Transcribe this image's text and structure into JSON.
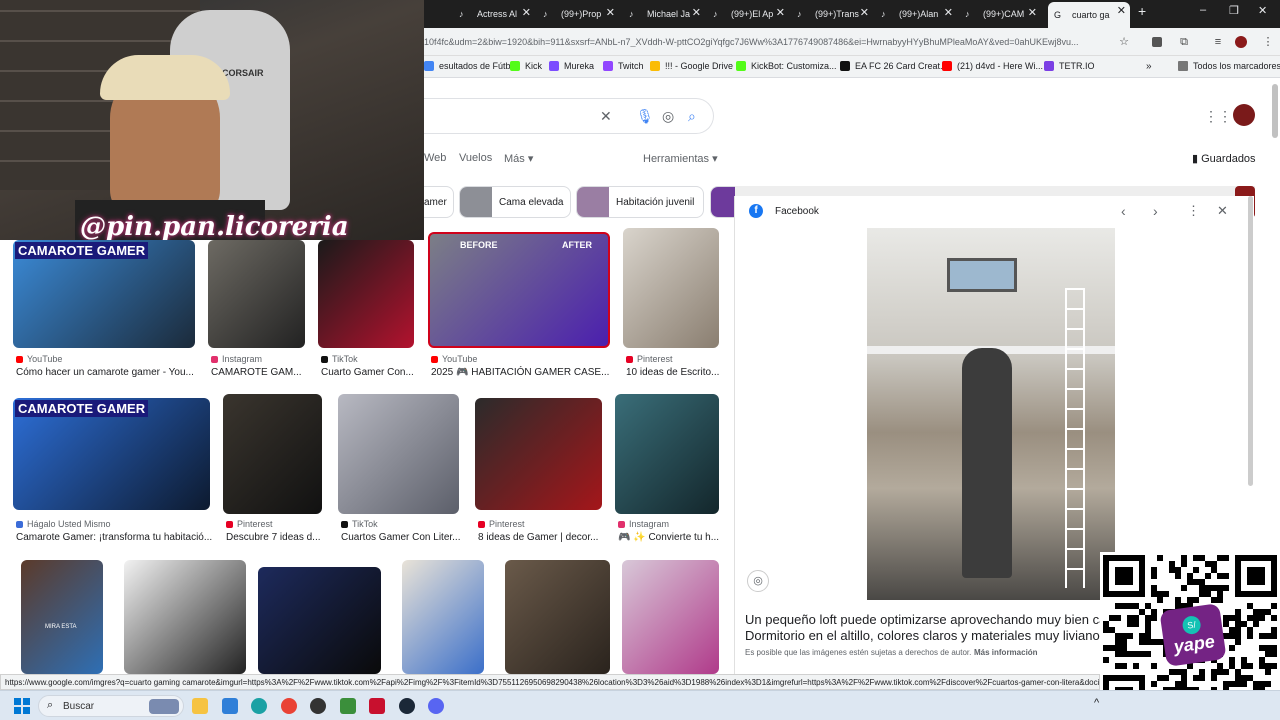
{
  "browser": {
    "tabs": [
      {
        "label": "Actress Al"
      },
      {
        "label": "(99+)Prop"
      },
      {
        "label": "Michael Ja"
      },
      {
        "label": "(99+)El Ap"
      },
      {
        "label": "(99+)Trans"
      },
      {
        "label": "(99+)Alan"
      },
      {
        "label": "(99+)CAM"
      },
      {
        "label": "cuarto ga"
      }
    ],
    "new_tab": "+",
    "url": "10f4fc&udm=2&biw=1920&bih=911&sxsrf=ANbL-n7_XVddh-W-pttCO2giYqfgc7J6Ww%3A1776749087486&ei=HwrnabyyHYyBhuMPleaMoAY&ved=0ahUKEwj8vu..."
  },
  "bookmarks": [
    {
      "label": "esultados de Fútb...",
      "color": "#4285f4"
    },
    {
      "label": "Kick",
      "color": "#53fc18"
    },
    {
      "label": "Mureka",
      "color": "#7c4dff"
    },
    {
      "label": "Twitch",
      "color": "#9146ff"
    },
    {
      "label": "!!! - Google Drive",
      "color": "#fbbc04"
    },
    {
      "label": "KickBot: Customiza...",
      "color": "#53fc18"
    },
    {
      "label": "EA FC 26 Card Creat...",
      "color": "#111111"
    },
    {
      "label": "(21) d4vd - Here Wi...",
      "color": "#ff0000"
    },
    {
      "label": "TETR.IO",
      "color": "#7b3fe4"
    }
  ],
  "bookmarks_other": "Todos los marcadores",
  "nav": {
    "web": "Web",
    "videos": "Vuelos",
    "mas": "Más",
    "herramientas": "Herramientas",
    "guardados": "Guardados"
  },
  "chips": [
    {
      "label": "amer"
    },
    {
      "label": "Cama elevada"
    },
    {
      "label": "Habitación juvenil"
    }
  ],
  "overlay": {
    "webcam_brand": "CORSAIR",
    "handle": "@pin.pan.licoreria"
  },
  "results": [
    {
      "source": "YouTube",
      "title": "Cómo hacer un camarote gamer - You...",
      "icon_color": "#ff0000",
      "banner": "CAMAROTE GAMER",
      "colors": [
        "#3b8bd8",
        "#1b2a3a"
      ]
    },
    {
      "source": "Instagram",
      "title": "CAMAROTE GAM...",
      "icon_color": "#e1306c",
      "colors": [
        "#6d6a63",
        "#222"
      ]
    },
    {
      "source": "TikTok",
      "title": "Cuarto Gamer Con...",
      "icon_color": "#111111",
      "colors": [
        "#1a1a1a",
        "#b3122e"
      ]
    },
    {
      "source": "YouTube",
      "title": "2025 🎮 HABITACIÓN GAMER CASE...",
      "icon_color": "#ff0000",
      "before": "BEFORE",
      "after": "AFTER",
      "colors": [
        "#7c7f86",
        "#4b1fae"
      ]
    },
    {
      "source": "Pinterest",
      "title": "10 ideas de Escrito...",
      "icon_color": "#e60023",
      "colors": [
        "#d9d4cc",
        "#8a7e70"
      ]
    },
    {
      "source": "Hágalo Usted Mismo",
      "title": "Camarote Gamer: ¡transforma tu habitació...",
      "icon_color": "#3b6cd8",
      "banner": "CAMAROTE GAMER",
      "colors": [
        "#2d6fd8",
        "#0d1a2f"
      ]
    },
    {
      "source": "Pinterest",
      "title": "Descubre 7 ideas d...",
      "icon_color": "#e60023",
      "colors": [
        "#3a352e",
        "#111"
      ]
    },
    {
      "source": "TikTok",
      "title": "Cuartos Gamer Con Liter...",
      "icon_color": "#111111",
      "colors": [
        "#b8b9c2",
        "#5c5f6a"
      ]
    },
    {
      "source": "Pinterest",
      "title": "8 ideas de Gamer | decor...",
      "icon_color": "#e60023",
      "colors": [
        "#2b2b2b",
        "#a4161a"
      ]
    },
    {
      "source": "Instagram",
      "title": "🎮 ✨ Convierte tu h...",
      "icon_color": "#e1306c",
      "colors": [
        "#3a6e79",
        "#13262b"
      ]
    },
    {
      "source": "",
      "title": "",
      "icon_color": "#fff",
      "caption": "MIRA ESTA",
      "colors": [
        "#5b3a2a",
        "#2e6fb5"
      ]
    },
    {
      "source": "",
      "title": "",
      "icon_color": "#fff",
      "colors": [
        "#f2f2f2",
        "#222"
      ]
    },
    {
      "source": "",
      "title": "",
      "icon_color": "#fff",
      "colors": [
        "#1d2a5c",
        "#0a0a0a"
      ]
    },
    {
      "source": "",
      "title": "",
      "icon_color": "#fff",
      "colors": [
        "#e9e3d8",
        "#3b6fc9"
      ]
    },
    {
      "source": "",
      "title": "",
      "icon_color": "#fff",
      "colors": [
        "#6a5a4a",
        "#2a231d"
      ]
    },
    {
      "source": "",
      "title": "",
      "icon_color": "#fff",
      "colors": [
        "#d8c8d8",
        "#b03a8a"
      ]
    }
  ],
  "panel": {
    "source": "Facebook",
    "caption_line1": "Un pequeño loft puede optimizarse aprovechando muy bien cada",
    "caption_line2": "Dormitorio en el altillo, colores claros y materiales muy livianos. La",
    "copyright": "Es posible que las imágenes estén sujetas a derechos de autor.",
    "more_info": "Más información"
  },
  "qr": {
    "brand": "yape",
    "currency": "S/"
  },
  "status_url": "https://www.google.com/imgres?q=cuarto gaming camarote&imgurl=https%3A%2F%2Fwww.tiktok.com%2Fapi%2Fimg%2F%3FitemId%3D7551126950698290438%26location%3D3%26aid%3D1988%26index%3D1&imgrefurl=https%3A%2F%2Fwww.tiktok.com%2Fdiscover%2Fcuartos-gamer-con-litera&docid",
  "taskbar": {
    "search_placeholder": "Buscar",
    "apps": [
      {
        "name": "file-explorer",
        "color": "#f6c342"
      },
      {
        "name": "store",
        "color": "#2f7fd8"
      },
      {
        "name": "edge",
        "color": "#1ba1a4"
      },
      {
        "name": "chrome",
        "color": "#e94235"
      },
      {
        "name": "obs",
        "color": "#333"
      },
      {
        "name": "notepad",
        "color": "#3b8f3b"
      },
      {
        "name": "app-red",
        "color": "#c8102e"
      },
      {
        "name": "steam",
        "color": "#1b2838"
      },
      {
        "name": "discord",
        "color": "#5865f2"
      }
    ]
  }
}
